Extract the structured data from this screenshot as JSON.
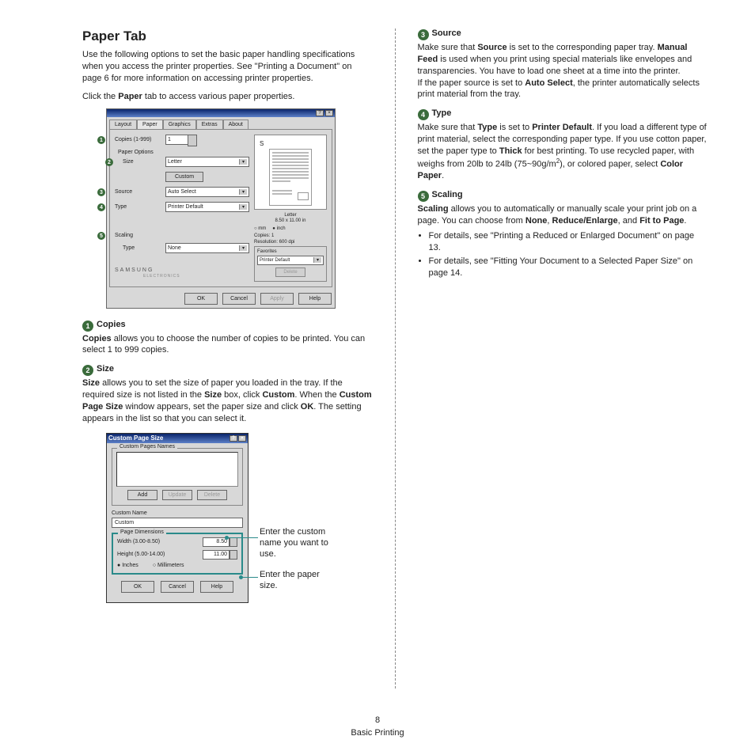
{
  "page": {
    "title": "Paper Tab",
    "intro1": "Use the following options to set the basic paper handling specifications when you access the printer properties. See \"Printing a Document\" on page 6 for more information on accessing printer properties.",
    "intro2_a": "Click the ",
    "intro2_b": "Paper",
    "intro2_c": " tab to access various paper properties.",
    "page_num": "8",
    "section_label": "Basic Printing"
  },
  "dialog1": {
    "tabs": {
      "layout": "Layout",
      "paper": "Paper",
      "graphics": "Graphics",
      "extras": "Extras",
      "about": "About"
    },
    "copies_label": "Copies (1-999)",
    "copies_value": "1",
    "paper_options": "Paper Options",
    "size_label": "Size",
    "size_value": "Letter",
    "custom_btn": "Custom",
    "source_label": "Source",
    "source_value": "Auto Select",
    "type_label": "Type",
    "type_value": "Printer Default",
    "scaling_label": "Scaling",
    "scaling_type_label": "Type",
    "scaling_value": "None",
    "preview_label": "S",
    "preview_caption1": "Letter",
    "preview_caption2": "8.50 x 11.00 in",
    "unit_mm": "mm",
    "unit_inch": "inch",
    "copies_preview": "Copies: 1",
    "resolution": "Resolution: 600 dpi",
    "favorites": "Favorites",
    "favorites_value": "Printer Default",
    "delete_btn": "Delete",
    "logo": "SAMSUNG",
    "logo_sub": "ELECTRONICS",
    "ok": "OK",
    "cancel": "Cancel",
    "apply": "Apply",
    "help": "Help"
  },
  "sections": {
    "copies": {
      "num": "1",
      "title": "Copies",
      "body_a": "Copies",
      "body_b": " allows you to choose the number of copies to be printed. You can select 1 to 999 copies."
    },
    "size": {
      "num": "2",
      "title": "Size",
      "body_a": "Size",
      "body_b": " allows you to set the size of paper you loaded in the tray. If the required size is not listed in the ",
      "body_c": "Size",
      "body_d": " box, click ",
      "body_e": "Custom",
      "body_f": ". When the ",
      "body_g": "Custom Page Size",
      "body_h": " window appears, set the paper size and click ",
      "body_i": "OK",
      "body_j": ". The setting appears in the list so that you can select it."
    },
    "source": {
      "num": "3",
      "title": "Source",
      "p1_a": "Make sure that ",
      "p1_b": "Source",
      "p1_c": " is set to the corresponding paper tray. ",
      "p1_d": "Manual Feed",
      "p1_e": " is used when you print using special materials like envelopes and transparencies.  You have to load one sheet at a time into the printer.",
      "p2_a": "If the paper source is set to ",
      "p2_b": "Auto Select",
      "p2_c": ", the printer automatically selects print material from the tray."
    },
    "type": {
      "num": "4",
      "title": "Type",
      "body_a": "Make sure that ",
      "body_b": "Type",
      "body_c": " is set to ",
      "body_d": "Printer Default",
      "body_e": ". If you load a different type of print material, select the corresponding paper type. If you use cotton paper, set the paper type to ",
      "body_f": "Thick",
      "body_g": " for best printing. To use recycled paper, with weighs from 20lb to 24lb (75~90g/m",
      "body_h": "2",
      "body_i": "), or colored paper, select ",
      "body_j": "Color Paper",
      "body_k": "."
    },
    "scaling": {
      "num": "5",
      "title": "Scaling",
      "body_a": "Scaling",
      "body_b": " allows you to automatically or manually scale your print job on a page. You can choose from ",
      "body_c": "None",
      "body_d": ", ",
      "body_e": "Reduce/Enlarge",
      "body_f": ", and ",
      "body_g": "Fit to Page",
      "body_h": ".",
      "li1": "For details, see \"Printing a Reduced or Enlarged Document\" on page 13.",
      "li2": "For details, see \"Fitting Your Document to a Selected Paper Size\" on page 14."
    }
  },
  "dialog2": {
    "title": "Custom Page Size",
    "group_names": "Custom Pages Names",
    "add": "Add",
    "update": "Update",
    "delete": "Delete",
    "custom_name_label": "Custom Name",
    "custom_name_value": "Custom",
    "group_dim": "Page Dimensions",
    "width_label": "Width  (3.00-8.50)",
    "width_value": "8.50",
    "height_label": "Height (5.00-14.00)",
    "height_value": "11.00",
    "inches": "Inches",
    "mm": "Millimeters",
    "ok": "OK",
    "cancel": "Cancel",
    "help": "Help"
  },
  "annotations": {
    "a1": "Enter the custom name you want to use.",
    "a2": "Enter the paper size."
  }
}
